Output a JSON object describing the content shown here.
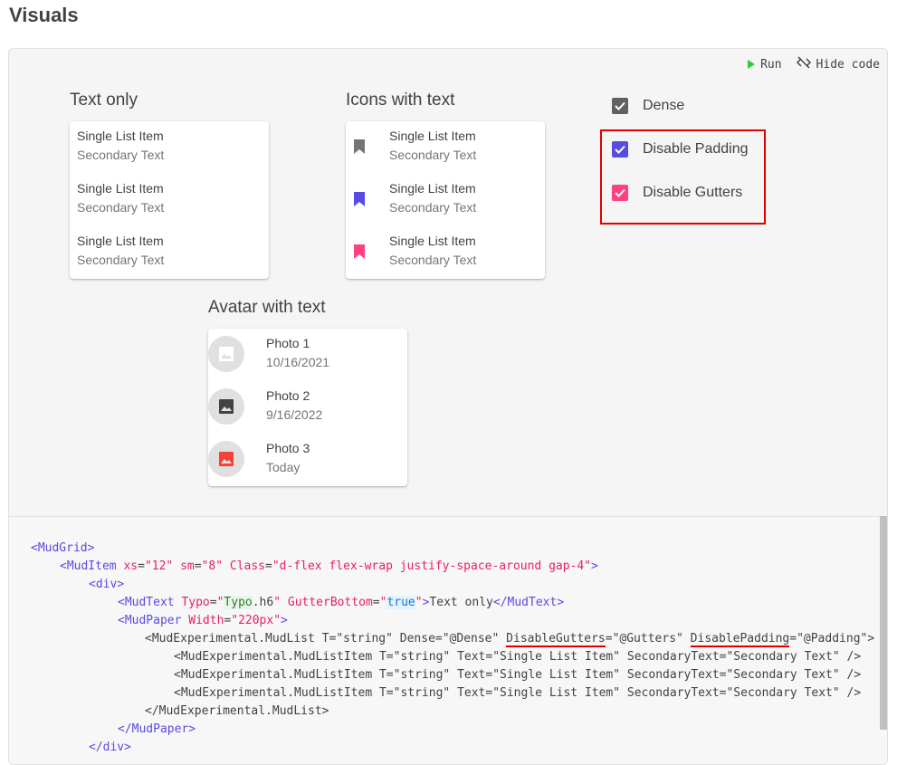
{
  "page": {
    "title": "Visuals"
  },
  "toolbar": {
    "run_label": "Run",
    "hide_code_label": "Hide code"
  },
  "sections": {
    "text_only": {
      "title": "Text only",
      "items": [
        {
          "primary": "Single List Item",
          "secondary": "Secondary Text"
        },
        {
          "primary": "Single List Item",
          "secondary": "Secondary Text"
        },
        {
          "primary": "Single List Item",
          "secondary": "Secondary Text"
        }
      ]
    },
    "icons_with_text": {
      "title": "Icons with text",
      "items": [
        {
          "primary": "Single List Item",
          "secondary": "Secondary Text",
          "icon": "bookmark-icon",
          "color": "#757575"
        },
        {
          "primary": "Single List Item",
          "secondary": "Secondary Text",
          "icon": "bookmark-icon",
          "color": "#594ae2"
        },
        {
          "primary": "Single List Item",
          "secondary": "Secondary Text",
          "icon": "bookmark-icon",
          "color": "#ff4081"
        }
      ]
    },
    "avatar_with_text": {
      "title": "Avatar with text",
      "items": [
        {
          "primary": "Photo 1",
          "secondary": "10/16/2021",
          "icon": "image-icon",
          "color": "#ffffff"
        },
        {
          "primary": "Photo 2",
          "secondary": "9/16/2022",
          "icon": "image-icon",
          "color": "#424242"
        },
        {
          "primary": "Photo 3",
          "secondary": "Today",
          "icon": "image-icon",
          "color": "#f44336"
        }
      ]
    }
  },
  "options": [
    {
      "label": "Dense",
      "checked": true,
      "color": "#616161"
    },
    {
      "label": "Disable Padding",
      "checked": true,
      "color": "#594ae2"
    },
    {
      "label": "Disable Gutters",
      "checked": true,
      "color": "#ff4081"
    }
  ],
  "code": {
    "l1": {
      "open": "<",
      "tag": "MudGrid",
      "close": ">"
    },
    "l2": {
      "open": "<",
      "tag": "MudItem",
      "a1": "xs",
      "eq": "=",
      "v1": "\"12\"",
      "a2": "sm",
      "v2": "\"8\"",
      "a3": "Class",
      "v3": "\"d-flex flex-wrap justify-space-around gap-4\"",
      "close": ">"
    },
    "l3": {
      "open": "<",
      "tag": "div",
      "close": ">"
    },
    "l4": {
      "open": "<",
      "tag": "MudText",
      "a1": "Typo",
      "q": "\"",
      "v1": "Typo",
      "v1b": ".h6",
      "a2": "GutterBottom",
      "v2": "true",
      "text": "Text only",
      "close_open": "</",
      "close": ">"
    },
    "l5": {
      "open": "<",
      "tag": "MudPaper",
      "a1": "Width",
      "v1": "\"220px\"",
      "close": ">"
    },
    "l6": {
      "pre": "<MudExperimental.MudList T=\"string\" Dense=\"@Dense\" ",
      "ul1": "DisableGutters",
      "mid": "=\"@Gutters\" ",
      "ul2": "DisablePadding",
      "post": "=\"@Padding\">"
    },
    "l7": "<MudExperimental.MudListItem T=\"string\" Text=\"Single List Item\" SecondaryText=\"Secondary Text\" />",
    "l8": "<MudExperimental.MudListItem T=\"string\" Text=\"Single List Item\" SecondaryText=\"Secondary Text\" />",
    "l9": "<MudExperimental.MudListItem T=\"string\" Text=\"Single List Item\" SecondaryText=\"Secondary Text\" />",
    "l10": "</MudExperimental.MudList>",
    "l11": {
      "open": "</",
      "tag": "MudPaper",
      "close": ">"
    },
    "l12": {
      "open": "</",
      "tag": "div",
      "close": ">"
    }
  }
}
